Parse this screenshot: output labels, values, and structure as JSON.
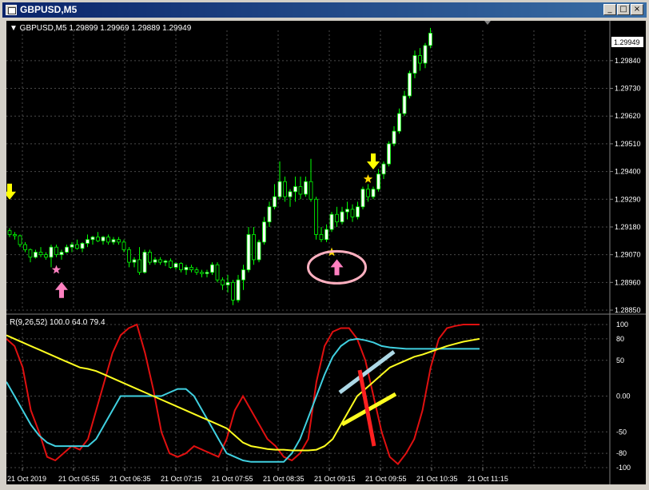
{
  "window": {
    "title": "GBPUSD,M5",
    "buttons": {
      "minimize": "_",
      "maximize": "□",
      "close": "×"
    }
  },
  "price_chart": {
    "header": "▼ GBPUSD,M5  1.29899 1.29969 1.29889 1.29949",
    "current_price": "1.29949",
    "y_ticks": [
      "1.29840",
      "1.29730",
      "1.29620",
      "1.29510",
      "1.29400",
      "1.29290",
      "1.29180",
      "1.29070",
      "1.28960",
      "1.28850"
    ]
  },
  "indicator": {
    "header": "R(9,26,52) 100.0 64.0 79.4",
    "y_ticks": [
      "100",
      "80",
      "50",
      "0.00",
      "-50",
      "-80",
      "-100"
    ]
  },
  "x_labels": [
    "21 Oct 2019",
    "21 Oct 05:55",
    "21 Oct 06:35",
    "21 Oct 07:15",
    "21 Oct 07:55",
    "21 Oct 08:35",
    "21 Oct 09:15",
    "21 Oct 09:55",
    "21 Oct 10:35",
    "21 Oct 11:15"
  ],
  "colors": {
    "background": "#000000",
    "grid": "#4a4a4a",
    "bull_candle": "#ffffff",
    "bear_candle": "#000000",
    "candle_wick": "#00ff00",
    "line_red": "#e01010",
    "line_cyan": "#40d0e0",
    "line_yellow": "#ffff20",
    "arrow_up": "#ff80c0",
    "arrow_down": "#ffff00"
  },
  "chart_data": {
    "type": "candlestick",
    "symbol": "GBPUSD",
    "timeframe": "M5",
    "ylim": [
      1.2885,
      1.2996
    ],
    "candles": [
      [
        1.29165,
        1.29175,
        1.2914,
        1.2915
      ],
      [
        1.2915,
        1.2916,
        1.2913,
        1.29145
      ],
      [
        1.29145,
        1.2915,
        1.291,
        1.2911
      ],
      [
        1.2911,
        1.2912,
        1.2908,
        1.2909
      ],
      [
        1.2909,
        1.29095,
        1.2904,
        1.2906
      ],
      [
        1.2906,
        1.2909,
        1.29055,
        1.2908
      ],
      [
        1.2908,
        1.291,
        1.2906,
        1.2907
      ],
      [
        1.2907,
        1.2908,
        1.2905,
        1.2906
      ],
      [
        1.2906,
        1.2911,
        1.2902,
        1.291
      ],
      [
        1.291,
        1.2911,
        1.2906,
        1.2907
      ],
      [
        1.2907,
        1.2909,
        1.2905,
        1.2908
      ],
      [
        1.2908,
        1.2911,
        1.29075,
        1.291
      ],
      [
        1.291,
        1.2912,
        1.2908,
        1.2911
      ],
      [
        1.2911,
        1.2913,
        1.2909,
        1.29095
      ],
      [
        1.29095,
        1.2912,
        1.2908,
        1.29115
      ],
      [
        1.29115,
        1.2915,
        1.291,
        1.2913
      ],
      [
        1.2913,
        1.29145,
        1.2911,
        1.2914
      ],
      [
        1.2914,
        1.2916,
        1.2912,
        1.29125
      ],
      [
        1.29125,
        1.29145,
        1.2911,
        1.2914
      ],
      [
        1.2914,
        1.2915,
        1.2911,
        1.2912
      ],
      [
        1.2912,
        1.2914,
        1.2911,
        1.2913
      ],
      [
        1.2913,
        1.2914,
        1.2911,
        1.2912
      ],
      [
        1.2912,
        1.2913,
        1.2908,
        1.2909
      ],
      [
        1.2909,
        1.291,
        1.2902,
        1.2904
      ],
      [
        1.2904,
        1.2906,
        1.2902,
        1.2905
      ],
      [
        1.2905,
        1.291,
        1.2899,
        1.29
      ],
      [
        1.29,
        1.2909,
        1.28995,
        1.2908
      ],
      [
        1.2908,
        1.2909,
        1.2903,
        1.2904
      ],
      [
        1.2904,
        1.2906,
        1.2903,
        1.2905
      ],
      [
        1.2905,
        1.2906,
        1.2903,
        1.2904
      ],
      [
        1.2904,
        1.2905,
        1.29025,
        1.29045
      ],
      [
        1.29045,
        1.29055,
        1.29015,
        1.2902
      ],
      [
        1.2902,
        1.2904,
        1.2901,
        1.29035
      ],
      [
        1.29035,
        1.2904,
        1.29,
        1.2901
      ],
      [
        1.2901,
        1.2903,
        1.2899,
        1.2902
      ],
      [
        1.2902,
        1.2903,
        1.29,
        1.2901
      ],
      [
        1.2901,
        1.2902,
        1.2899,
        1.29
      ],
      [
        1.29,
        1.2901,
        1.2898,
        1.28995
      ],
      [
        1.28995,
        1.2901,
        1.2898,
        1.29
      ],
      [
        1.29,
        1.2904,
        1.2899,
        1.2903
      ],
      [
        1.2903,
        1.2904,
        1.2896,
        1.2897
      ],
      [
        1.2897,
        1.2898,
        1.2893,
        1.2895
      ],
      [
        1.2895,
        1.2899,
        1.2892,
        1.2896
      ],
      [
        1.2896,
        1.2897,
        1.2887,
        1.2889
      ],
      [
        1.2889,
        1.2899,
        1.2888,
        1.2897
      ],
      [
        1.2897,
        1.2903,
        1.2893,
        1.2901
      ],
      [
        1.2901,
        1.2918,
        1.29,
        1.2915
      ],
      [
        1.2915,
        1.2918,
        1.2903,
        1.2905
      ],
      [
        1.2905,
        1.2913,
        1.2904,
        1.2912
      ],
      [
        1.2912,
        1.2922,
        1.2911,
        1.292
      ],
      [
        1.292,
        1.2928,
        1.2918,
        1.2926
      ],
      [
        1.2926,
        1.2935,
        1.2925,
        1.293
      ],
      [
        1.293,
        1.2944,
        1.2929,
        1.2936
      ],
      [
        1.2936,
        1.2938,
        1.2928,
        1.293
      ],
      [
        1.293,
        1.2933,
        1.2926,
        1.2932
      ],
      [
        1.2932,
        1.2938,
        1.2928,
        1.2934
      ],
      [
        1.2934,
        1.2938,
        1.2929,
        1.2931
      ],
      [
        1.2931,
        1.2938,
        1.293,
        1.2936
      ],
      [
        1.2936,
        1.2945,
        1.2928,
        1.2929
      ],
      [
        1.2929,
        1.293,
        1.2913,
        1.2915
      ],
      [
        1.2915,
        1.2918,
        1.2912,
        1.2913
      ],
      [
        1.2913,
        1.2919,
        1.2912,
        1.2917
      ],
      [
        1.2917,
        1.2924,
        1.2916,
        1.2923
      ],
      [
        1.2923,
        1.2926,
        1.2918,
        1.292
      ],
      [
        1.292,
        1.2926,
        1.2919,
        1.2924
      ],
      [
        1.2924,
        1.2928,
        1.2921,
        1.2925
      ],
      [
        1.2925,
        1.2927,
        1.292,
        1.2922
      ],
      [
        1.2922,
        1.2928,
        1.2921,
        1.2926
      ],
      [
        1.2926,
        1.2934,
        1.2925,
        1.2933
      ],
      [
        1.2933,
        1.2935,
        1.2928,
        1.293
      ],
      [
        1.293,
        1.2934,
        1.2929,
        1.2933
      ],
      [
        1.2933,
        1.2941,
        1.2932,
        1.2939
      ],
      [
        1.2939,
        1.2944,
        1.2937,
        1.2943
      ],
      [
        1.2943,
        1.2952,
        1.2942,
        1.2951
      ],
      [
        1.2951,
        1.2958,
        1.295,
        1.2956
      ],
      [
        1.2956,
        1.2965,
        1.2955,
        1.2963
      ],
      [
        1.2963,
        1.2972,
        1.2962,
        1.297
      ],
      [
        1.297,
        1.298,
        1.2969,
        1.2979
      ],
      [
        1.2979,
        1.2988,
        1.2977,
        1.2986
      ],
      [
        1.2986,
        1.2989,
        1.298,
        1.2983
      ],
      [
        1.2983,
        1.2991,
        1.2981,
        1.299
      ],
      [
        1.299,
        1.2997,
        1.29889,
        1.29949
      ]
    ],
    "markers": [
      {
        "type": "arrow-down",
        "index": 0,
        "price": 1.2932
      },
      {
        "type": "arrow-up",
        "index": 10,
        "price": 1.2893
      },
      {
        "type": "star",
        "index": 9,
        "price": 1.2901
      },
      {
        "type": "arrow-up",
        "index": 63,
        "price": 1.2902
      },
      {
        "type": "star",
        "index": 62,
        "price": 1.2908
      },
      {
        "type": "arrow-down",
        "index": 70,
        "price": 1.2944
      },
      {
        "type": "star",
        "index": 69,
        "price": 1.2937
      }
    ],
    "indicator": {
      "name": "R(9,26,52)",
      "values_last": [
        100.0,
        64.0,
        79.4
      ],
      "ylim": [
        -100,
        100
      ],
      "series": [
        {
          "color": "#e01010",
          "values": [
            80,
            70,
            40,
            -20,
            -50,
            -85,
            -90,
            -80,
            -70,
            -75,
            -60,
            -20,
            20,
            60,
            85,
            95,
            100,
            60,
            10,
            -50,
            -80,
            -85,
            -80,
            -70,
            -75,
            -80,
            -85,
            -60,
            -20,
            0,
            -20,
            -40,
            -60,
            -70,
            -85,
            -90,
            -80,
            -60,
            20,
            70,
            90,
            95,
            95,
            80,
            50,
            0,
            -50,
            -85,
            -95,
            -80,
            -60,
            -20,
            40,
            80,
            95,
            98,
            100,
            100,
            100
          ]
        },
        {
          "color": "#40d0e0",
          "values": [
            20,
            0,
            -20,
            -40,
            -55,
            -65,
            -70,
            -70,
            -70,
            -70,
            -70,
            -60,
            -40,
            -20,
            0,
            0,
            0,
            0,
            0,
            0,
            5,
            10,
            10,
            0,
            -20,
            -40,
            -60,
            -80,
            -85,
            -90,
            -92,
            -92,
            -92,
            -92,
            -92,
            -80,
            -60,
            -30,
            0,
            30,
            55,
            70,
            78,
            80,
            78,
            75,
            70,
            68,
            67,
            66,
            66,
            66,
            66,
            66,
            66,
            66,
            66,
            66,
            66
          ]
        },
        {
          "color": "#ffff20",
          "values": [
            85,
            80,
            75,
            70,
            65,
            60,
            55,
            50,
            45,
            40,
            38,
            35,
            30,
            25,
            20,
            15,
            10,
            5,
            0,
            -5,
            -10,
            -15,
            -20,
            -25,
            -30,
            -35,
            -40,
            -45,
            -55,
            -65,
            -70,
            -72,
            -74,
            -75,
            -75,
            -76,
            -76,
            -76,
            -75,
            -70,
            -60,
            -40,
            -20,
            0,
            10,
            20,
            30,
            40,
            45,
            50,
            55,
            58,
            62,
            66,
            70,
            73,
            76,
            78,
            80
          ]
        }
      ]
    }
  }
}
